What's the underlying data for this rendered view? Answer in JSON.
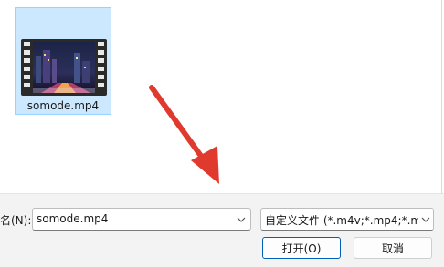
{
  "file_area": {
    "files": [
      {
        "name": "somode.mp4",
        "icon": "video-file-icon"
      }
    ]
  },
  "footer": {
    "filename_label": "名(N):",
    "filename_value": "somode.mp4",
    "file_type_value": "自定义文件 (*.m4v;*.mp4;*.m4",
    "open_button": "打开(O)",
    "cancel_button": "取消"
  },
  "colors": {
    "selection_bg": "#cce8ff",
    "selection_border": "#99d1ff",
    "panel_bg": "#f3f3f3",
    "primary_border": "#005fb8",
    "annotation_arrow": "#e03a2f"
  }
}
